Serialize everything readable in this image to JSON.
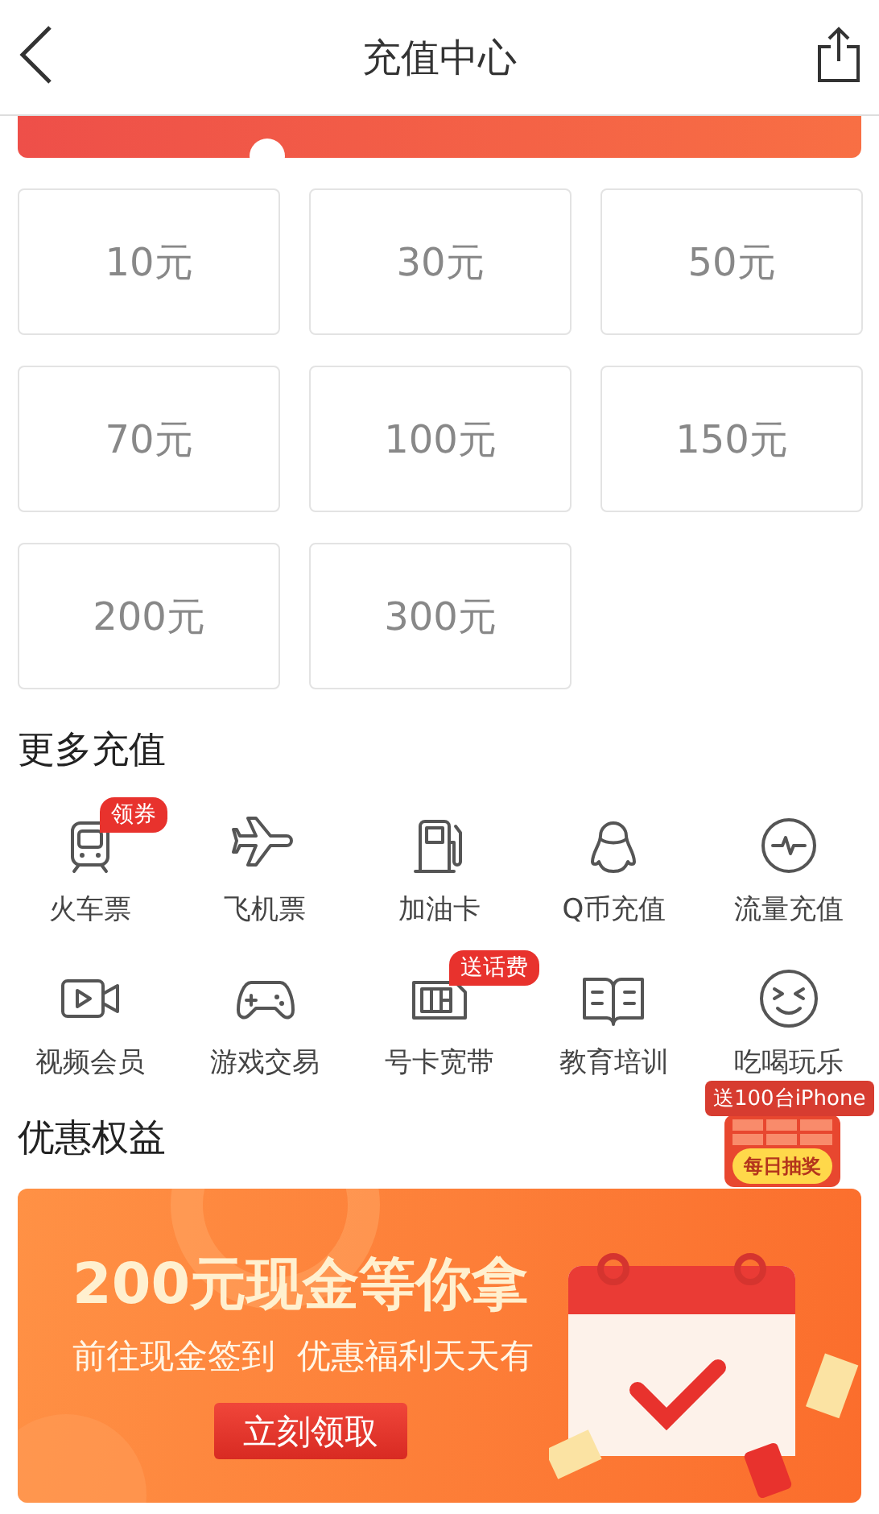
{
  "header": {
    "title": "充值中心"
  },
  "amounts": [
    "10元",
    "30元",
    "50元",
    "70元",
    "100元",
    "150元",
    "200元",
    "300元"
  ],
  "more": {
    "heading": "更多充值",
    "items": [
      {
        "label": "火车票",
        "badge": "领券"
      },
      {
        "label": "飞机票"
      },
      {
        "label": "加油卡"
      },
      {
        "label": "Q币充值"
      },
      {
        "label": "流量充值"
      },
      {
        "label": "视频会员"
      },
      {
        "label": "游戏交易"
      },
      {
        "label": "号卡宽带",
        "badge": "送话费"
      },
      {
        "label": "教育培训"
      },
      {
        "label": "吃喝玩乐"
      }
    ]
  },
  "benefits": {
    "heading": "优惠权益",
    "banner": {
      "title": "200元现金等你拿",
      "subtitle": "前往现金签到  优惠福利天天有",
      "button": "立刻领取"
    }
  },
  "lottery": {
    "badge": "送100台iPhone",
    "button": "每日抽奖"
  }
}
